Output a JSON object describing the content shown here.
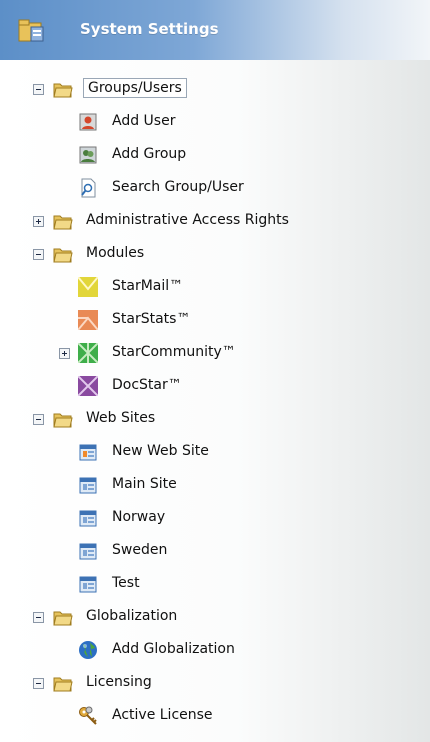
{
  "header": {
    "title": "System Settings",
    "icon": "folder-settings-icon"
  },
  "tree": {
    "groups_users": "Groups/Users",
    "add_user": "Add User",
    "add_group": "Add Group",
    "search_group_user": "Search Group/User",
    "admin_access": "Administrative Access Rights",
    "modules": "Modules",
    "starmail": "StarMail™",
    "starstats": "StarStats™",
    "starcommunity": "StarCommunity™",
    "docstar": "DocStar™",
    "web_sites": "Web Sites",
    "new_web_site": "New Web Site",
    "main_site": "Main Site",
    "norway": "Norway",
    "sweden": "Sweden",
    "test": "Test",
    "globalization": "Globalization",
    "add_globalization": "Add Globalization",
    "licensing": "Licensing",
    "active_license": "Active License"
  },
  "colors": {
    "header_blue": "#5c8fc8",
    "starmail": "#e2d63a",
    "starstats": "#e98a55",
    "starcommunity": "#3fae4a",
    "docstar": "#8a4aa0"
  }
}
